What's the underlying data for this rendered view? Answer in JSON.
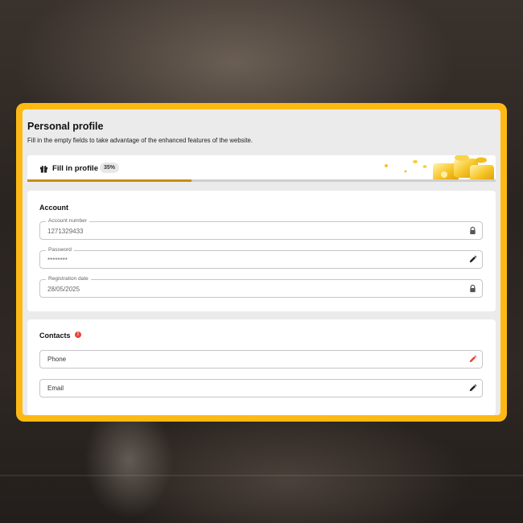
{
  "header": {
    "title": "Personal profile",
    "subtitle": "Fill in the empty fields to take advantage of the enhanced features of the website."
  },
  "progress": {
    "label": "Fill in profile",
    "percent_text": "35%",
    "value": 35,
    "icon": "gift-icon",
    "accent_color": "#c98d12"
  },
  "account": {
    "heading": "Account",
    "fields": [
      {
        "label": "Account number",
        "value": "1271329433",
        "icon": "lock-icon"
      },
      {
        "label": "Password",
        "value": "********",
        "icon": "pencil-icon"
      },
      {
        "label": "Registration date",
        "value": "28/05/2025",
        "icon": "lock-icon"
      }
    ]
  },
  "contacts": {
    "heading": "Contacts",
    "info_icon": "alert-icon",
    "fields": [
      {
        "placeholder": "Phone",
        "icon": "pencil-icon",
        "icon_color": "#e8443a"
      },
      {
        "placeholder": "Email",
        "icon": "pencil-icon",
        "icon_color": "#222222"
      }
    ]
  },
  "theme": {
    "frame_color": "#fdb913",
    "panel_color": "#ebebeb"
  }
}
